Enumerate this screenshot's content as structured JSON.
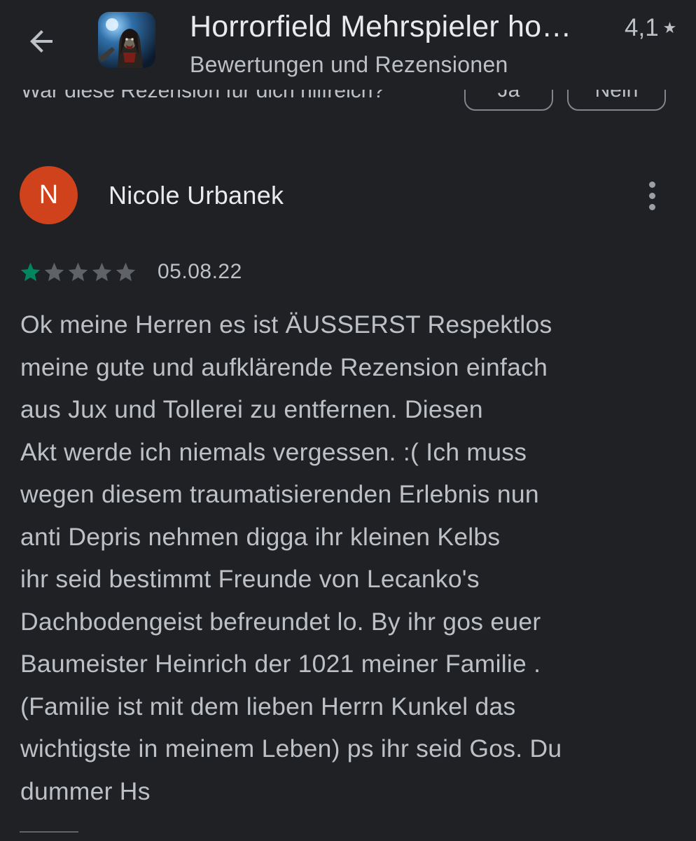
{
  "app": {
    "title": "Horrorfield Mehrspieler ho…",
    "rating": "4,1",
    "subtitle": "Bewertungen und Rezensionen"
  },
  "previous_review": {
    "helpful_question": "War diese Rezension für dich hilfreich?",
    "yes_label": "Ja",
    "no_label": "Nein"
  },
  "review": {
    "avatar_letter": "N",
    "avatar_color": "#d0421b",
    "author": "Nicole Urbanek",
    "rating": 1,
    "max_rating": 5,
    "date": "05.08.22",
    "text": "Ok meine Herren es ist ÄUSSERST Respektlos\nmeine gute und aufklärende Rezension einfach\naus Jux und Tollerei zu entfernen. Diesen\nAkt werde ich niemals vergessen. :( Ich muss\nwegen diesem traumatisierenden Erlebnis nun\nanti Depris nehmen digga ihr kleinen Kelbs\nihr seid bestimmt Freunde von Lecanko's\nDachbodengeist befreundet lo. By ihr gos euer\nBaumeister Heinrich der 1021 meiner Familie .\n(Familie ist mit dem lieben Herrn Kunkel das\nwichtigste in meinem Leben) ps ihr seid Gos. Du\ndummer Hs"
  },
  "colors": {
    "background": "#202124",
    "star_filled": "#01875f",
    "star_empty": "#5f6368"
  },
  "icons": {
    "back": "arrow-back-icon",
    "rating_star": "star-icon",
    "more": "more-vert-icon"
  }
}
